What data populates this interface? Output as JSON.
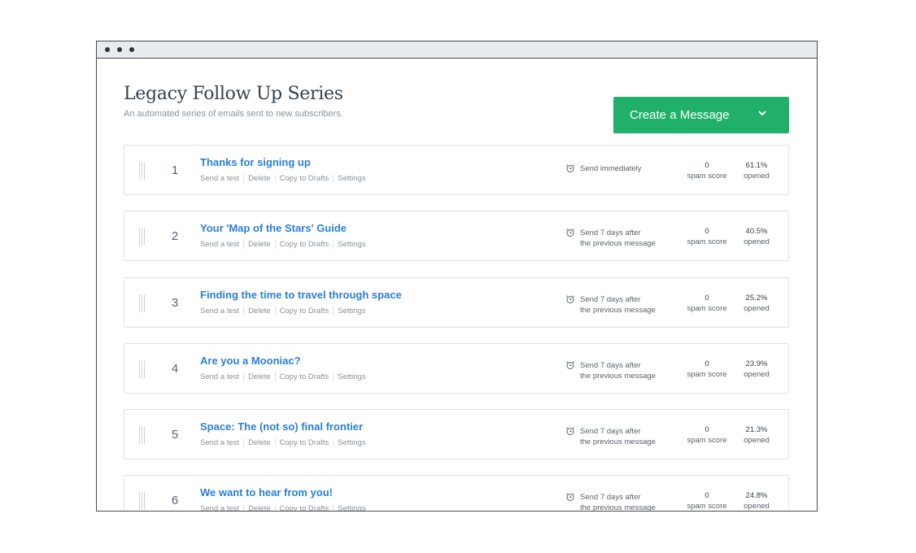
{
  "header": {
    "title": "Legacy Follow Up Series",
    "subtitle": "An automated series of emails sent to new subscribers.",
    "create_label": "Create a Message"
  },
  "actions": [
    "Send a test",
    "Delete",
    "Copy to Drafts",
    "Settings"
  ],
  "labels": {
    "spam": "spam score",
    "opened": "opened"
  },
  "messages": [
    {
      "num": "1",
      "title": "Thanks for signing up",
      "sched1": "Send immediately",
      "sched2": "",
      "spam": "0",
      "opened": "61.1%"
    },
    {
      "num": "2",
      "title": "Your 'Map of the Stars' Guide",
      "sched1": "Send 7 days after",
      "sched2": "the previous message",
      "spam": "0",
      "opened": "40.5%"
    },
    {
      "num": "3",
      "title": "Finding the time to travel through space",
      "sched1": "Send 7 days after",
      "sched2": "the previous message",
      "spam": "0",
      "opened": "25.2%"
    },
    {
      "num": "4",
      "title": "Are you a Mooniac?",
      "sched1": "Send 7 days after",
      "sched2": "the previous message",
      "spam": "0",
      "opened": "23.9%"
    },
    {
      "num": "5",
      "title": "Space: The (not so) final frontier",
      "sched1": "Send 7 days after",
      "sched2": "the previous message",
      "spam": "0",
      "opened": "21.3%"
    },
    {
      "num": "6",
      "title": "We want to hear from you!",
      "sched1": "Send 7 days after",
      "sched2": "the previous message",
      "spam": "0",
      "opened": "24.8%"
    }
  ],
  "colors": {
    "accent": "#21b06a",
    "link": "#2a7fd4"
  },
  "icons": {
    "create_dropdown": "chevron-down-icon",
    "schedule": "alarm-clock-icon",
    "drag": "drag-handle-icon"
  }
}
